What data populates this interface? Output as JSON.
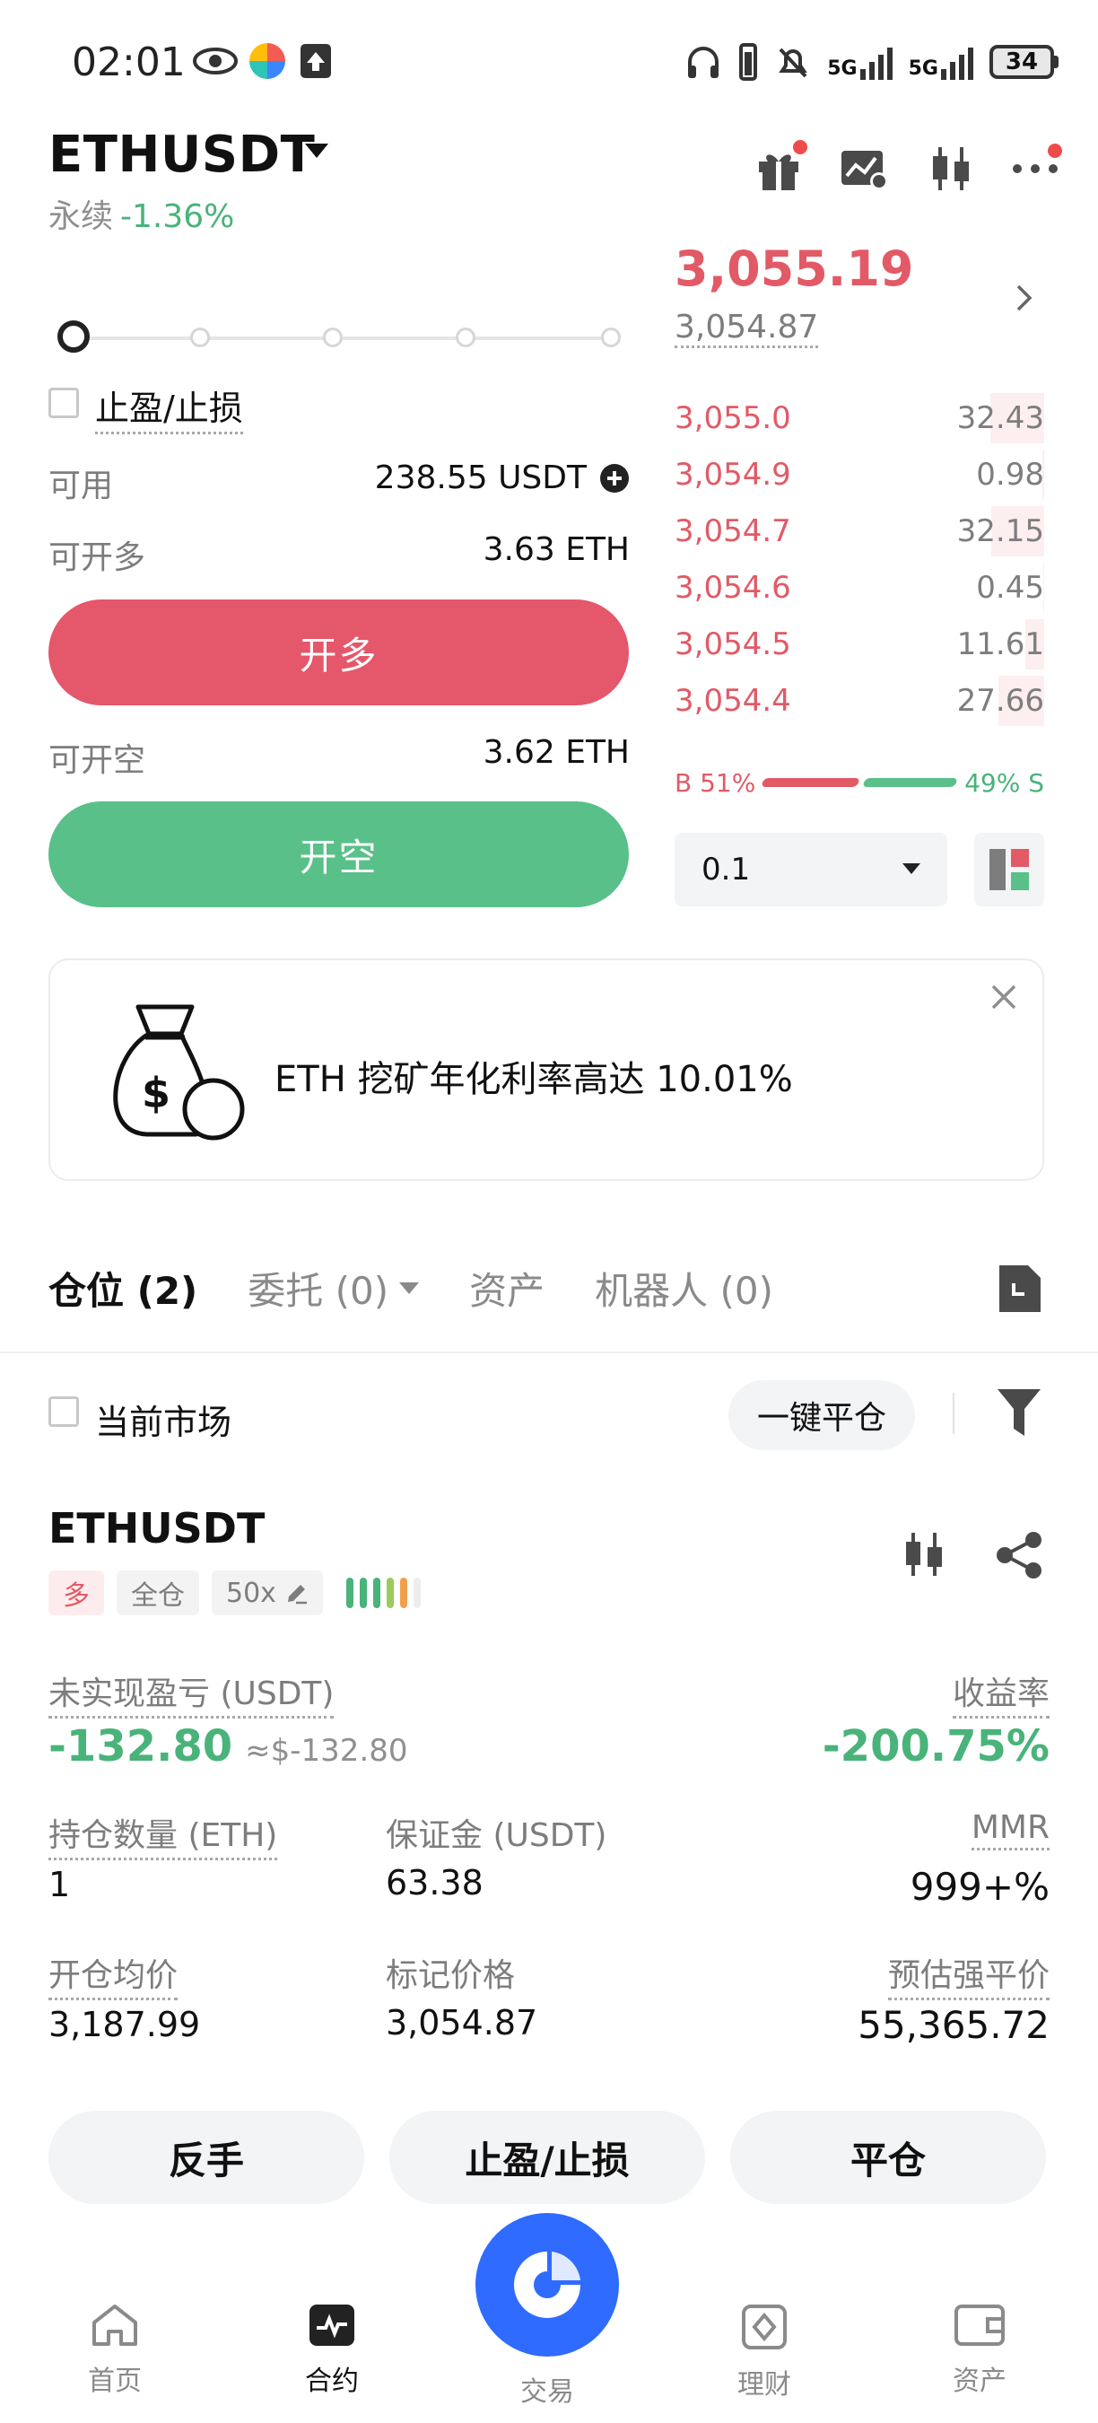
{
  "status_bar": {
    "time": "02:01",
    "battery": "34",
    "network1": "5G",
    "network2": "5G"
  },
  "header": {
    "pair": "ETHUSDT",
    "contract_type": "永续",
    "change": "-1.36%"
  },
  "form": {
    "tp_sl_label": "止盈/止损",
    "available_label": "可用",
    "available_value": "238.55 USDT",
    "can_long_label": "可开多",
    "can_long_value": "3.63 ETH",
    "long_button": "开多",
    "can_short_label": "可开空",
    "can_short_value": "3.62 ETH",
    "short_button": "开空"
  },
  "orderbook": {
    "last_price": "3,055.19",
    "mark_price": "3,054.87",
    "asks": [
      {
        "price": "3,055.0",
        "qty": "32.43"
      },
      {
        "price": "3,054.9",
        "qty": "0.98"
      },
      {
        "price": "3,054.7",
        "qty": "32.15"
      },
      {
        "price": "3,054.6",
        "qty": "0.45"
      },
      {
        "price": "3,054.5",
        "qty": "11.61"
      },
      {
        "price": "3,054.4",
        "qty": "27.66"
      }
    ],
    "buy_ratio": "B 51%",
    "sell_ratio": "49% S",
    "buy_fraction": 0.51,
    "precision": "0.1"
  },
  "promo": {
    "text": "ETH 挖矿年化利率高达 10.01%"
  },
  "tabs": [
    {
      "label": "仓位 (2)"
    },
    {
      "label": "委托 (0)"
    },
    {
      "label": "资产"
    },
    {
      "label": "机器人 (0)"
    }
  ],
  "filter": {
    "current_market_label": "当前市场",
    "close_all_button": "一键平仓"
  },
  "position": {
    "symbol": "ETHUSDT",
    "side_badge": "多",
    "margin_mode_badge": "全仓",
    "leverage_badge": "50x",
    "unrealized_pnl_label": "未实现盈亏 (USDT)",
    "unrealized_pnl_value": "-132.80",
    "unrealized_pnl_usd": "≈$-132.80",
    "roe_label": "收益率",
    "roe_value": "-200.75%",
    "size_label": "持仓数量 (ETH)",
    "size_value": "1",
    "margin_label": "保证金 (USDT)",
    "margin_value": "63.38",
    "mmr_label": "MMR",
    "mmr_value": "999+%",
    "entry_label": "开仓均价",
    "entry_value": "3,187.99",
    "mark_label": "标记价格",
    "mark_value": "3,054.87",
    "liq_label": "预估强平价",
    "liq_value": "55,365.72",
    "btn_reverse": "反手",
    "btn_tpsl": "止盈/止损",
    "btn_close": "平仓"
  },
  "bottom_nav": [
    {
      "label": "首页",
      "icon": "home-icon"
    },
    {
      "label": "合约",
      "icon": "futures-icon"
    },
    {
      "label": "交易",
      "icon": "trade-icon"
    },
    {
      "label": "理财",
      "icon": "earn-icon"
    },
    {
      "label": "资产",
      "icon": "wallet-icon"
    }
  ],
  "colors": {
    "red": "#e15a66",
    "green": "#49b37a",
    "orange": "#f0a04b",
    "blue": "#2f6bff"
  }
}
